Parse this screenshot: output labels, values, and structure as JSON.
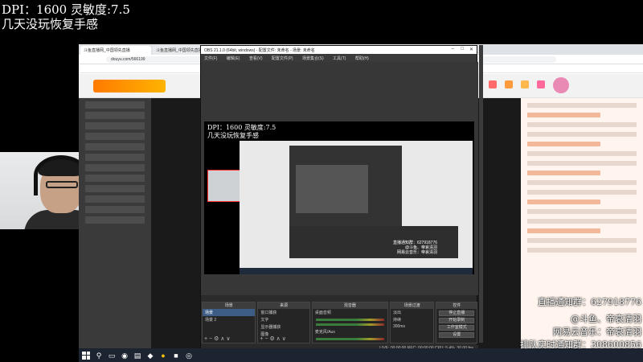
{
  "stream_overlay": {
    "dpi": "DPI：1600 灵敏度:7.5",
    "subtitle": "几天没玩恢复手感",
    "group_notice": "直播通知群：627918776",
    "douyu_credit": "@斗鱼、帝哀清羽",
    "netease_music": "网易云音乐：帝哀清羽",
    "queue_notice": "排队实时通知群：308600856"
  },
  "browser": {
    "tabs": [
      {
        "label": "斗鱼直播网_中国领先直播",
        "active": true
      },
      {
        "label": "斗鱼直播网_中国领先直播网",
        "active": false
      }
    ],
    "url": "douyu.com/566199"
  },
  "obs": {
    "title": "OBS 21.1.0 (64bit, windows) - 配置文件: 未命名 - 场景: 未命名",
    "menu": [
      "文件(F)",
      "编辑(E)",
      "查看(V)",
      "配置文件(P)",
      "场景集合(S)",
      "工具(T)",
      "帮助(H)"
    ],
    "docks": {
      "scenes": {
        "header": "场景",
        "items": [
          "场景",
          "场景 2"
        ]
      },
      "sources": {
        "header": "来源",
        "items": [
          "窗口捕获",
          "文字",
          "显示器捕获",
          "图像"
        ]
      },
      "mixer": {
        "header": "混音器",
        "items": [
          "桌面音频",
          "麦克风/Aux"
        ]
      },
      "transitions": {
        "header": "场景过渡",
        "value": "淡出",
        "duration_label": "持续",
        "duration": "300ms"
      },
      "controls": {
        "header": "控件",
        "buttons": [
          "停止直播",
          "开始录制",
          "工作室模式",
          "设置",
          "退出"
        ]
      }
    },
    "preview": {
      "dpi": "DPI：1600 灵敏度:7.5",
      "subtitle": "几天没玩恢复手感",
      "overlay_lines": [
        "直播通知群：627918776",
        "@斗鱼、帝哀清羽",
        "网易云音乐：帝哀清羽"
      ]
    },
    "status": "LIVE: 00:00:00   REC: 00:00:00   CPU: 5.4%, 30.00 fps"
  },
  "colors": {
    "accent_orange": "#ff7a00",
    "obs_dark": "#2b2b2b",
    "selected_blue": "#3d5d86"
  }
}
